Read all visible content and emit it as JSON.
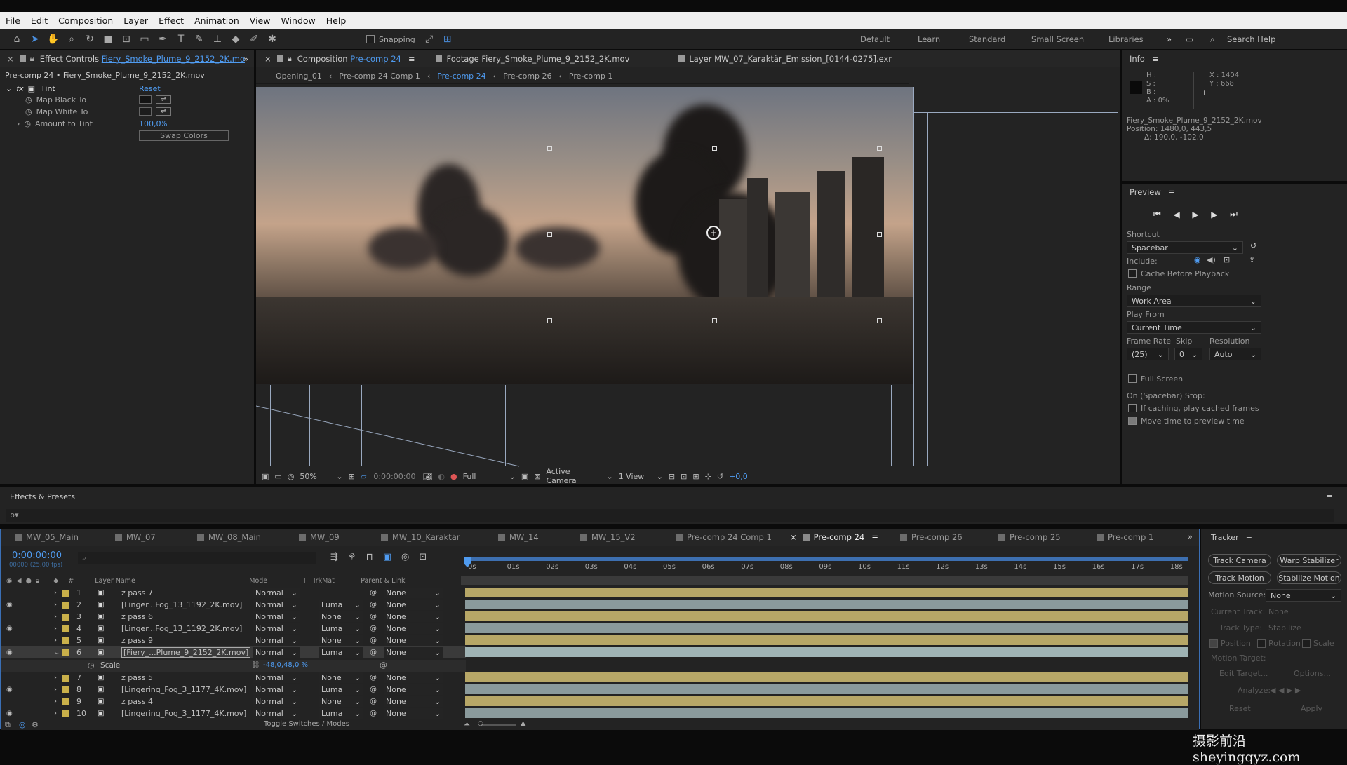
{
  "menu": [
    "File",
    "Edit",
    "Composition",
    "Layer",
    "Effect",
    "Animation",
    "View",
    "Window",
    "Help"
  ],
  "toolbar": {
    "snapping": "Snapping",
    "workspaces": [
      "Default",
      "Learn",
      "Standard",
      "Small Screen",
      "Libraries"
    ],
    "search": "Search Help"
  },
  "effect_controls": {
    "tab_prefix": "Effect Controls",
    "tab_file": "Fiery_Smoke_Plume_9_2152_2K.mo",
    "path": "Pre-comp 24 • Fiery_Smoke_Plume_9_2152_2K.mov",
    "effect": "Tint",
    "reset": "Reset",
    "props": [
      {
        "label": "Map Black To"
      },
      {
        "label": "Map White To"
      },
      {
        "label": "Amount to Tint",
        "value": "100,0",
        "unit": "%"
      }
    ],
    "swap": "Swap Colors"
  },
  "comp_panel": {
    "tab_prefix": "Composition",
    "tab_name": "Pre-comp 24",
    "footage_tab": "Footage  Fiery_Smoke_Plume_9_2152_2K.mov",
    "layer_tab": "Layer  MW_07_Karaktär_Emission_[0144-0275].exr",
    "breadcrumbs": [
      "Opening_01",
      "Pre-comp 24 Comp 1",
      "Pre-comp 24",
      "Pre-comp 26",
      "Pre-comp 1"
    ],
    "zoom": "50%",
    "time": "0:00:00:00",
    "resolution": "Full",
    "camera": "Active Camera",
    "view": "1 View",
    "exposure": "+0,0"
  },
  "info": {
    "title": "Info",
    "h": "H :",
    "s": "S :",
    "b": "B :",
    "a": "A :  0%",
    "x": "X : 1404",
    "y": "Y :  668",
    "file": "Fiery_Smoke_Plume_9_2152_2K.mov",
    "position": "Position: 1480,0, 443,5",
    "delta": "Δ: 190,0, -102,0"
  },
  "preview": {
    "title": "Preview",
    "shortcut_label": "Shortcut",
    "shortcut": "Spacebar",
    "include": "Include:",
    "cache": "Cache Before Playback",
    "range_label": "Range",
    "range": "Work Area",
    "playfrom_label": "Play From",
    "playfrom": "Current Time",
    "fr_label": "Frame Rate",
    "skip_label": "Skip",
    "res_label": "Resolution",
    "fr": "(25)",
    "skip": "0",
    "res": "Auto",
    "fullscreen": "Full Screen",
    "stop_label": "On (Spacebar) Stop:",
    "if_caching": "If caching, play cached frames",
    "move_time": "Move time to preview time"
  },
  "effects_presets": {
    "title": "Effects & Presets",
    "search": "ρ▾"
  },
  "timeline": {
    "tabs": [
      "MW_05_Main",
      "MW_07",
      "MW_08_Main",
      "MW_09",
      "MW_10_Karaktär",
      "MW_14",
      "MW_15_V2",
      "Pre-comp 24 Comp 1",
      "Pre-comp 24",
      "Pre-comp 26",
      "Pre-comp 25",
      "Pre-comp 1"
    ],
    "time": "0:00:00:00",
    "fps": "00000 (25.00 fps)",
    "cols": {
      "layer_name": "Layer Name",
      "mode": "Mode",
      "t": "T",
      "trkmat": "TrkMat",
      "parent": "Parent & Link"
    },
    "ticks": [
      "0s",
      "01s",
      "02s",
      "03s",
      "04s",
      "05s",
      "06s",
      "07s",
      "08s",
      "09s",
      "10s",
      "11s",
      "12s",
      "13s",
      "14s",
      "15s",
      "16s",
      "17s",
      "18s"
    ],
    "layers": [
      {
        "num": "1",
        "name": "z pass 7",
        "mode": "Normal",
        "trk": "",
        "parent": "None",
        "color": "#c9b04a",
        "eye": false,
        "bar": "yellow"
      },
      {
        "num": "2",
        "name": "[Linger...Fog_13_1192_2K.mov]",
        "mode": "Normal",
        "trk": "Luma",
        "parent": "None",
        "color": "#c9b04a",
        "eye": true,
        "bar": "grey"
      },
      {
        "num": "3",
        "name": "z pass 6",
        "mode": "Normal",
        "trk": "None",
        "parent": "None",
        "color": "#c9b04a",
        "eye": false,
        "bar": "yellow"
      },
      {
        "num": "4",
        "name": "[Linger...Fog_13_1192_2K.mov]",
        "mode": "Normal",
        "trk": "Luma",
        "parent": "None",
        "color": "#c9b04a",
        "eye": true,
        "bar": "grey"
      },
      {
        "num": "5",
        "name": "z pass 9",
        "mode": "Normal",
        "trk": "None",
        "parent": "None",
        "color": "#c9b04a",
        "eye": false,
        "bar": "yellow"
      },
      {
        "num": "6",
        "name": "[Fiery_...Plume_9_2152_2K.mov]",
        "mode": "Normal",
        "trk": "Luma",
        "parent": "None",
        "color": "#c9b04a",
        "eye": true,
        "bar": "teal"
      },
      {
        "num": "7",
        "name": "z pass 5",
        "mode": "Normal",
        "trk": "None",
        "parent": "None",
        "color": "#c9b04a",
        "eye": false,
        "bar": "yellow"
      },
      {
        "num": "8",
        "name": "[Lingering_Fog_3_1177_4K.mov]",
        "mode": "Normal",
        "trk": "Luma",
        "parent": "None",
        "color": "#c9b04a",
        "eye": true,
        "bar": "grey"
      },
      {
        "num": "9",
        "name": "z pass 4",
        "mode": "Normal",
        "trk": "None",
        "parent": "None",
        "color": "#c9b04a",
        "eye": false,
        "bar": "yellow"
      },
      {
        "num": "10",
        "name": "[Lingering_Fog_3_1177_4K.mov]",
        "mode": "Normal",
        "trk": "Luma",
        "parent": "None",
        "color": "#c9b04a",
        "eye": true,
        "bar": "grey"
      }
    ],
    "scale_label": "Scale",
    "scale_value": "-48,0,48,0 %",
    "toggle": "Toggle Switches / Modes"
  },
  "tracker": {
    "title": "Tracker",
    "track_camera": "Track Camera",
    "warp": "Warp Stabilizer",
    "track_motion": "Track Motion",
    "stabilize": "Stabilize Motion",
    "motion_source_label": "Motion Source:",
    "motion_source": "None",
    "current_track": "Current Track:",
    "current_track_val": "None",
    "track_type": "Track Type:",
    "track_type_val": "Stabilize",
    "position": "Position",
    "rotation": "Rotation",
    "scale": "Scale",
    "motion_target": "Motion Target:",
    "edit_target": "Edit Target...",
    "options": "Options...",
    "analyze": "Analyze:",
    "reset": "Reset",
    "apply": "Apply"
  },
  "watermark": "摄影前沿 sheyingqyz.com"
}
